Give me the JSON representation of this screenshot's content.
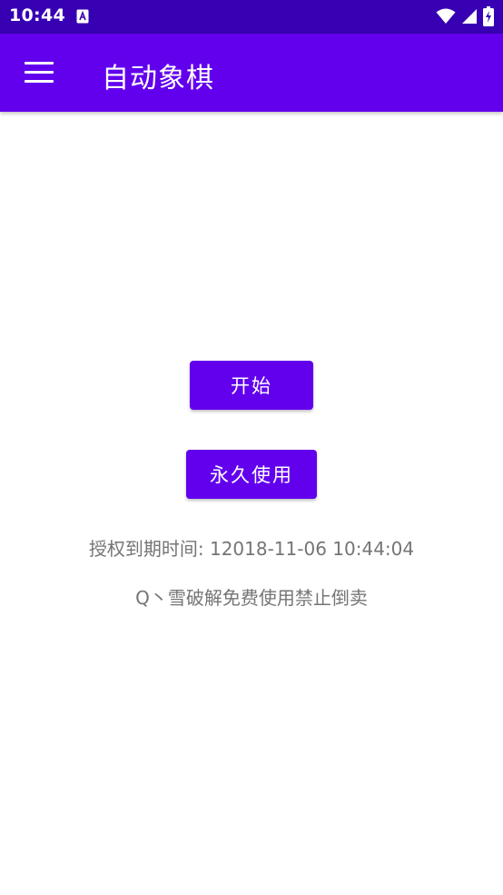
{
  "status_bar": {
    "time": "10:44",
    "app_icon": "a-letter-icon",
    "icons": [
      "wifi-icon",
      "signal-icon",
      "battery-charging-icon"
    ]
  },
  "app_bar": {
    "title": "自动象棋",
    "menu_icon": "menu-icon"
  },
  "buttons": {
    "start_label": "开始",
    "forever_label": "永久使用"
  },
  "info": {
    "expire_label": "授权到期时间: 12018-11-06 10:44:04",
    "notice": "Q丶雪破解免费使用禁止倒卖"
  },
  "colors": {
    "status_bar": "#3700b3",
    "primary": "#6200ee",
    "text_secondary": "#757575"
  }
}
